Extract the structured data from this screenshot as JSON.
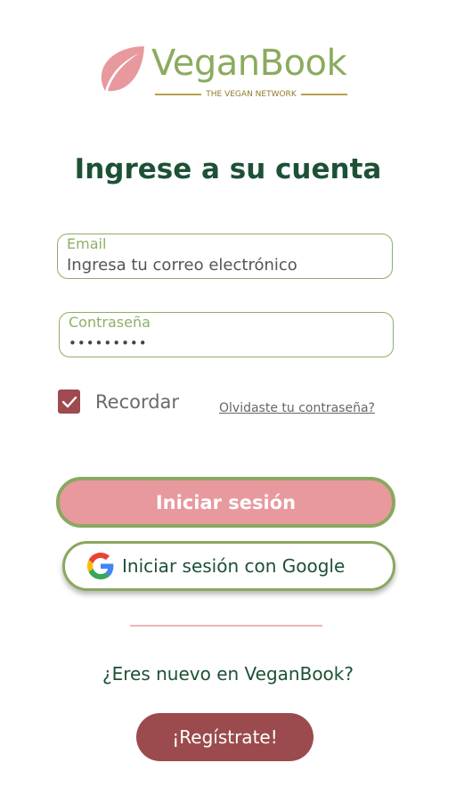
{
  "brand": {
    "name": "VeganBook",
    "tagline": "THE VEGAN NETWORK"
  },
  "heading": "Ingrese a su cuenta",
  "form": {
    "email_label": "Email",
    "email_placeholder": "Ingresa tu correo electrónico",
    "password_label": "Contraseña",
    "password_value": "•••••••••",
    "remember_label": "Recordar",
    "remember_checked": true,
    "forgot_link": "Olvidaste tu contraseña?",
    "login_button": "Iniciar sesión",
    "google_button": "Iniciar sesión con Google"
  },
  "signup": {
    "prompt": "¿Eres nuevo en VeganBook?",
    "button": "¡Regístrate!"
  },
  "colors": {
    "brand_green": "#8bab5e",
    "heading_green": "#1d5136",
    "login_pink": "#e8999d",
    "register_maroon": "#9b4b4d",
    "checkbox_maroon": "#9e4a4e"
  }
}
